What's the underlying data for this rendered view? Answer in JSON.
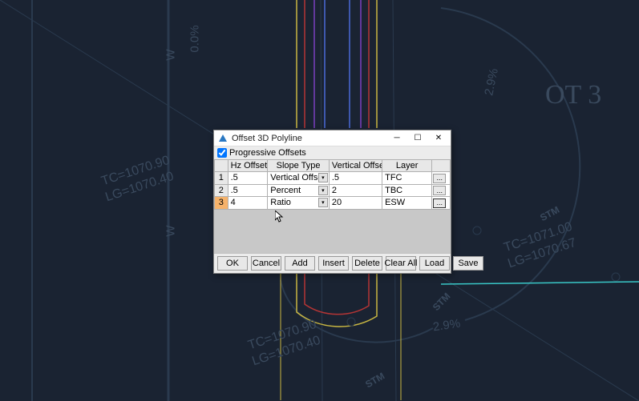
{
  "dialog": {
    "title": "Offset 3D Polyline",
    "progressive_label": "Progressive Offsets",
    "progressive_checked": true,
    "columns": {
      "hz": "Hz Offset",
      "slope": "Slope Type",
      "vert": "Vertical Offset",
      "layer": "Layer"
    },
    "rows": [
      {
        "num": "1",
        "hz": ".5",
        "slope": "Vertical Offset",
        "vert": ".5",
        "layer": "TFC",
        "selected": false
      },
      {
        "num": "2",
        "hz": ".5",
        "slope": "Percent",
        "vert": "2",
        "layer": "TBC",
        "selected": false
      },
      {
        "num": "3",
        "hz": "4",
        "slope": "Ratio",
        "vert": "20",
        "layer": "ESW",
        "selected": true
      }
    ],
    "buttons": {
      "ok": "OK",
      "cancel": "Cancel",
      "add": "Add",
      "insert": "Insert",
      "delete": "Delete",
      "clear": "Clear All",
      "load": "Load",
      "save": "Save"
    }
  },
  "bg": {
    "labels": {
      "tc1": "TC=1070.90",
      "lg1": "LG=1070.40",
      "tc2": "TC=1071.00",
      "lg2": "LG=1070.67",
      "tc3": "TC=1070.90",
      "lg3": "LG=1070.40",
      "ot": "OT 3",
      "pct1": "2.9%",
      "pct2": "2.9%",
      "pct3": "0.0%",
      "w1": "W",
      "w2": "W",
      "stm1": "STM",
      "stm2": "STM",
      "stm3": "STM"
    },
    "colors": {
      "yellow": "#c9b742",
      "red": "#b53535",
      "blue": "#4a6bd8",
      "purple": "#7a3fbf",
      "cyan": "#39c7c7"
    }
  }
}
